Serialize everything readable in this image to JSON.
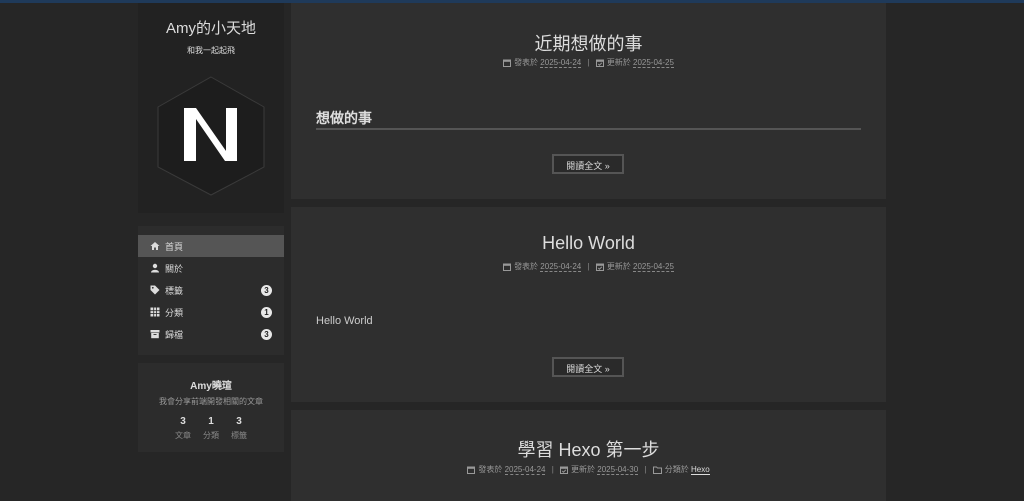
{
  "site": {
    "title": "Amy的小天地",
    "subtitle": "和我一起起飛"
  },
  "menu": {
    "items": [
      {
        "label": "首頁",
        "icon": "home-icon",
        "badge": ""
      },
      {
        "label": "關於",
        "icon": "user-icon",
        "badge": ""
      },
      {
        "label": "標籤",
        "icon": "tags-icon",
        "badge": "3"
      },
      {
        "label": "分類",
        "icon": "th-icon",
        "badge": "1"
      },
      {
        "label": "歸檔",
        "icon": "archive-icon",
        "badge": "3"
      }
    ]
  },
  "author": {
    "name": "Amy曉瑄",
    "description": "我會分享前端開發相關的文章",
    "stats": [
      {
        "num": "3",
        "label": "文章"
      },
      {
        "num": "1",
        "label": "分類"
      },
      {
        "num": "3",
        "label": "標籤"
      }
    ]
  },
  "posts": [
    {
      "title": "近期想做的事",
      "posted_label": "發表於",
      "posted_date": "2025-04-24",
      "updated_label": "更新於",
      "updated_date": "2025-04-25",
      "heading": "想做的事",
      "read_more": "閱讀全文 »"
    },
    {
      "title": "Hello World",
      "posted_label": "發表於",
      "posted_date": "2025-04-24",
      "updated_label": "更新於",
      "updated_date": "2025-04-25",
      "body": "Hello World",
      "read_more": "閱讀全文 »"
    },
    {
      "title": "學習 Hexo 第一步",
      "posted_label": "發表於",
      "posted_date": "2025-04-24",
      "updated_label": "更新於",
      "updated_date": "2025-04-30",
      "category_label": "分類於",
      "category": "Hexo"
    }
  ],
  "meta_separator": "|"
}
